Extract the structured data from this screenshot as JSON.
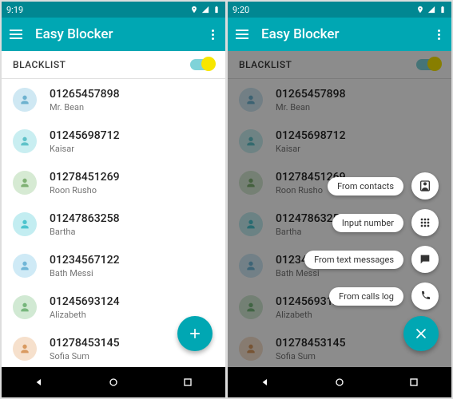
{
  "leftScreen": {
    "status_time": "9:19",
    "app_title": "Easy Blocker",
    "section_label": "BLACKLIST",
    "fab_icon": "plus",
    "contacts": [
      {
        "number": "01265457898",
        "name": "Mr. Bean",
        "avatar": "av-blue"
      },
      {
        "number": "01245698712",
        "name": "Kaisar",
        "avatar": "av-teal"
      },
      {
        "number": "01278451269",
        "name": "Roon Rusho",
        "avatar": "av-green"
      },
      {
        "number": "01247863258",
        "name": "Bartha",
        "avatar": "av-cyan"
      },
      {
        "number": "01234567122",
        "name": "Bath Messi",
        "avatar": "av-sky"
      },
      {
        "number": "01245693124",
        "name": "Alizabeth",
        "avatar": "av-mint"
      },
      {
        "number": "01278453145",
        "name": "Sofia Sum",
        "avatar": "av-peach"
      }
    ]
  },
  "rightScreen": {
    "status_time": "9:20",
    "app_title": "Easy Blocker",
    "section_label": "BLACKLIST",
    "fab_icon": "close",
    "contacts": [
      {
        "number": "01265457898",
        "name": "Mr. Bean",
        "avatar": "av-blue"
      },
      {
        "number": "01245698712",
        "name": "Kaisar",
        "avatar": "av-teal"
      },
      {
        "number": "01278451269",
        "name": "Roon Rusho",
        "avatar": "av-green"
      },
      {
        "number": "01247863258",
        "name": "Bartha",
        "avatar": "av-cyan"
      },
      {
        "number": "01234567122",
        "name": "Bath Messi",
        "avatar": "av-sky"
      },
      {
        "number": "01245693124",
        "name": "Alizabeth",
        "avatar": "av-mint"
      },
      {
        "number": "01278453145",
        "name": "Sofia Sum",
        "avatar": "av-peach"
      }
    ],
    "speed_dial": [
      {
        "label": "From contacts",
        "icon": "contact"
      },
      {
        "label": "Input number",
        "icon": "dialpad"
      },
      {
        "label": "From text messages",
        "icon": "message"
      },
      {
        "label": "From calls log",
        "icon": "call"
      }
    ]
  }
}
